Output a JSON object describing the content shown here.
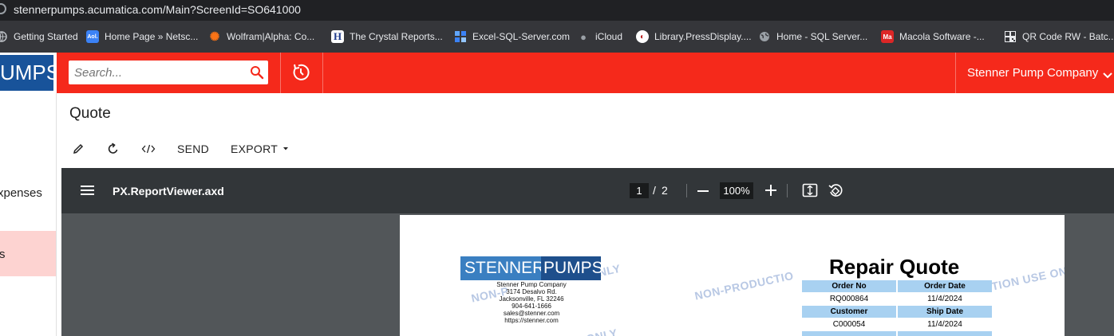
{
  "browser": {
    "url_host": "stennerpumps.acumatica.com",
    "url_path": "/Main?ScreenId=SO641000"
  },
  "bookmarks": [
    {
      "label": "Getting Started",
      "icon": "globe-icon"
    },
    {
      "label": "Home Page » Netsc...",
      "icon": "aol-icon"
    },
    {
      "label": "Wolfram|Alpha: Co...",
      "icon": "wolfram-icon"
    },
    {
      "label": "The Crystal Reports...",
      "icon": "h-icon"
    },
    {
      "label": "Excel-SQL-Server.com",
      "icon": "grid-icon"
    },
    {
      "label": "iCloud",
      "icon": "apple-icon"
    },
    {
      "label": "Library.PressDisplay....",
      "icon": "pressdisplay-icon"
    },
    {
      "label": "Home - SQL Server...",
      "icon": "globe-icon"
    },
    {
      "label": "Macola Software -...",
      "icon": "macola-icon"
    },
    {
      "label": "QR Code RW - Batc...",
      "icon": "qr-icon"
    }
  ],
  "header": {
    "logo_text": "UMPS",
    "search_placeholder": "Search...",
    "company": "Stenner Pump Company",
    "accent_color": "#f5291b"
  },
  "nav": {
    "items": [
      {
        "label": "xpenses"
      },
      {
        "label": "s"
      }
    ]
  },
  "screen": {
    "title": "Quote",
    "toolbar": {
      "send_label": "SEND",
      "export_label": "EXPORT"
    }
  },
  "viewer": {
    "filename": "PX.ReportViewer.axd",
    "page_current": "1",
    "page_separator": "/",
    "page_total": "2",
    "zoom": "100%"
  },
  "report": {
    "logo_left": "STENNER",
    "logo_right": "PUMPS",
    "company_lines": [
      "Stenner Pump Company",
      "3174 Desalvo Rd.",
      "Jacksonville, FL 32246",
      "904-641-1666",
      "sales@stenner.com",
      "https://stenner.com"
    ],
    "title": "Repair Quote",
    "watermark": "NON-PRODUCTION USE ONLY",
    "watermark_fragments": [
      "ONLY",
      "NON-P",
      "NON-PRODUCTIO",
      "TION USE ON",
      "ONLY"
    ],
    "fields": [
      {
        "label": "Order No",
        "value": "RQ000864"
      },
      {
        "label": "Order Date",
        "value": "11/4/2024"
      },
      {
        "label": "Customer",
        "value": "C000054"
      },
      {
        "label": "Ship Date",
        "value": "11/4/2024"
      }
    ]
  }
}
